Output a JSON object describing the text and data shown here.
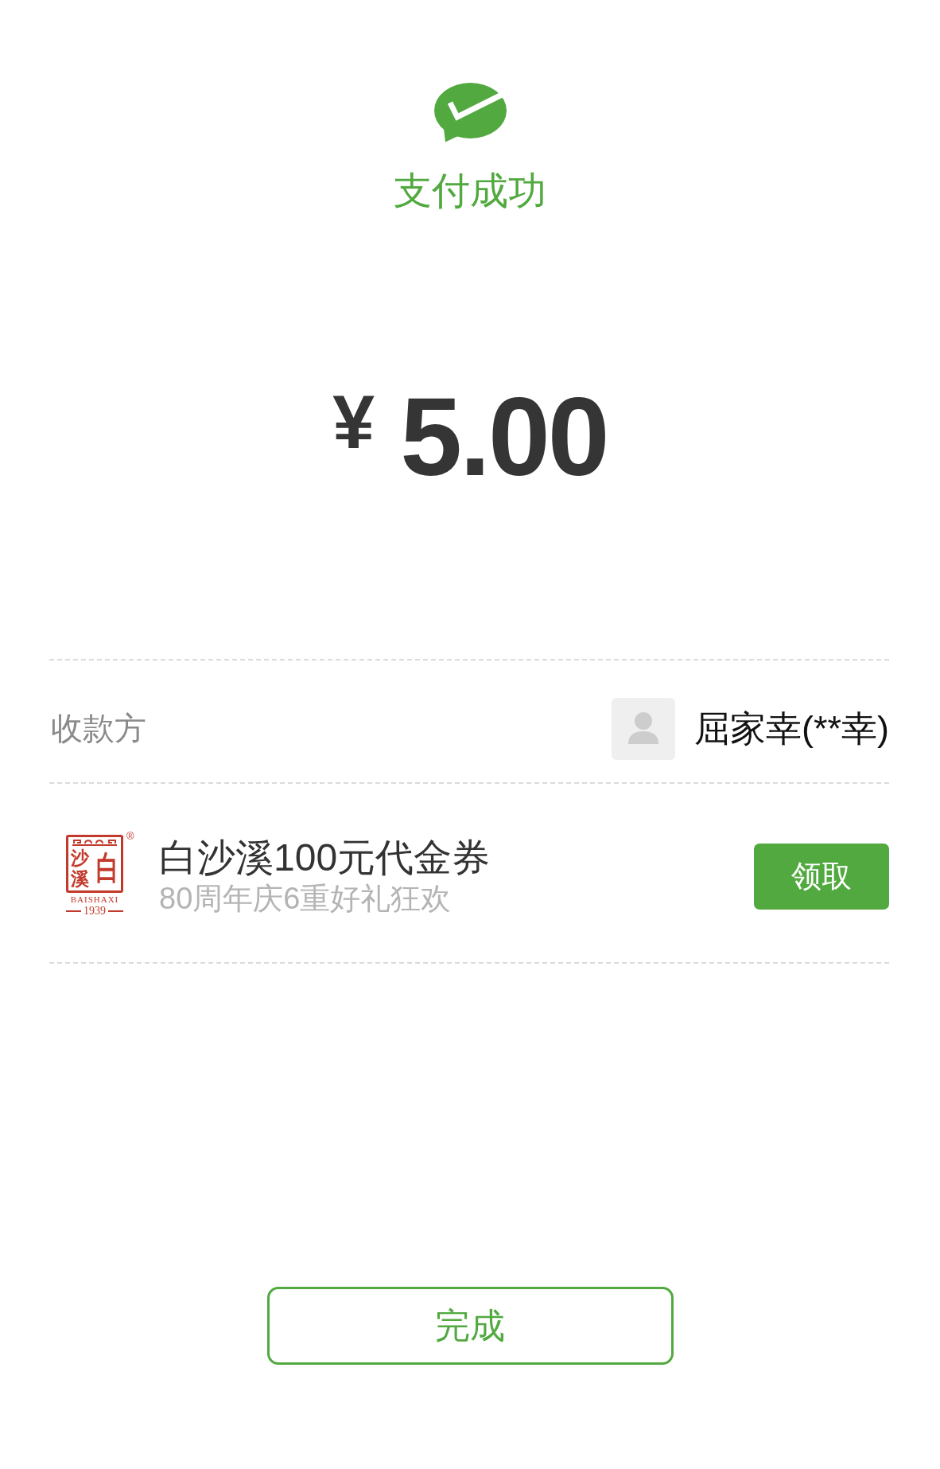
{
  "status": {
    "title": "支付成功"
  },
  "amount": {
    "currency": "¥",
    "value": "5.00"
  },
  "payee": {
    "label": "收款方",
    "name": "屈家幸(**幸)"
  },
  "coupon": {
    "logo": {
      "seal_right": "白",
      "seal_left": "沙溪",
      "trademark": "®",
      "romanized": "BAISHAXI",
      "year": "1939"
    },
    "title": "白沙溪100元代金券",
    "subtitle": "80周年庆6重好礼狂欢",
    "button": "领取"
  },
  "done_button": "完成"
}
